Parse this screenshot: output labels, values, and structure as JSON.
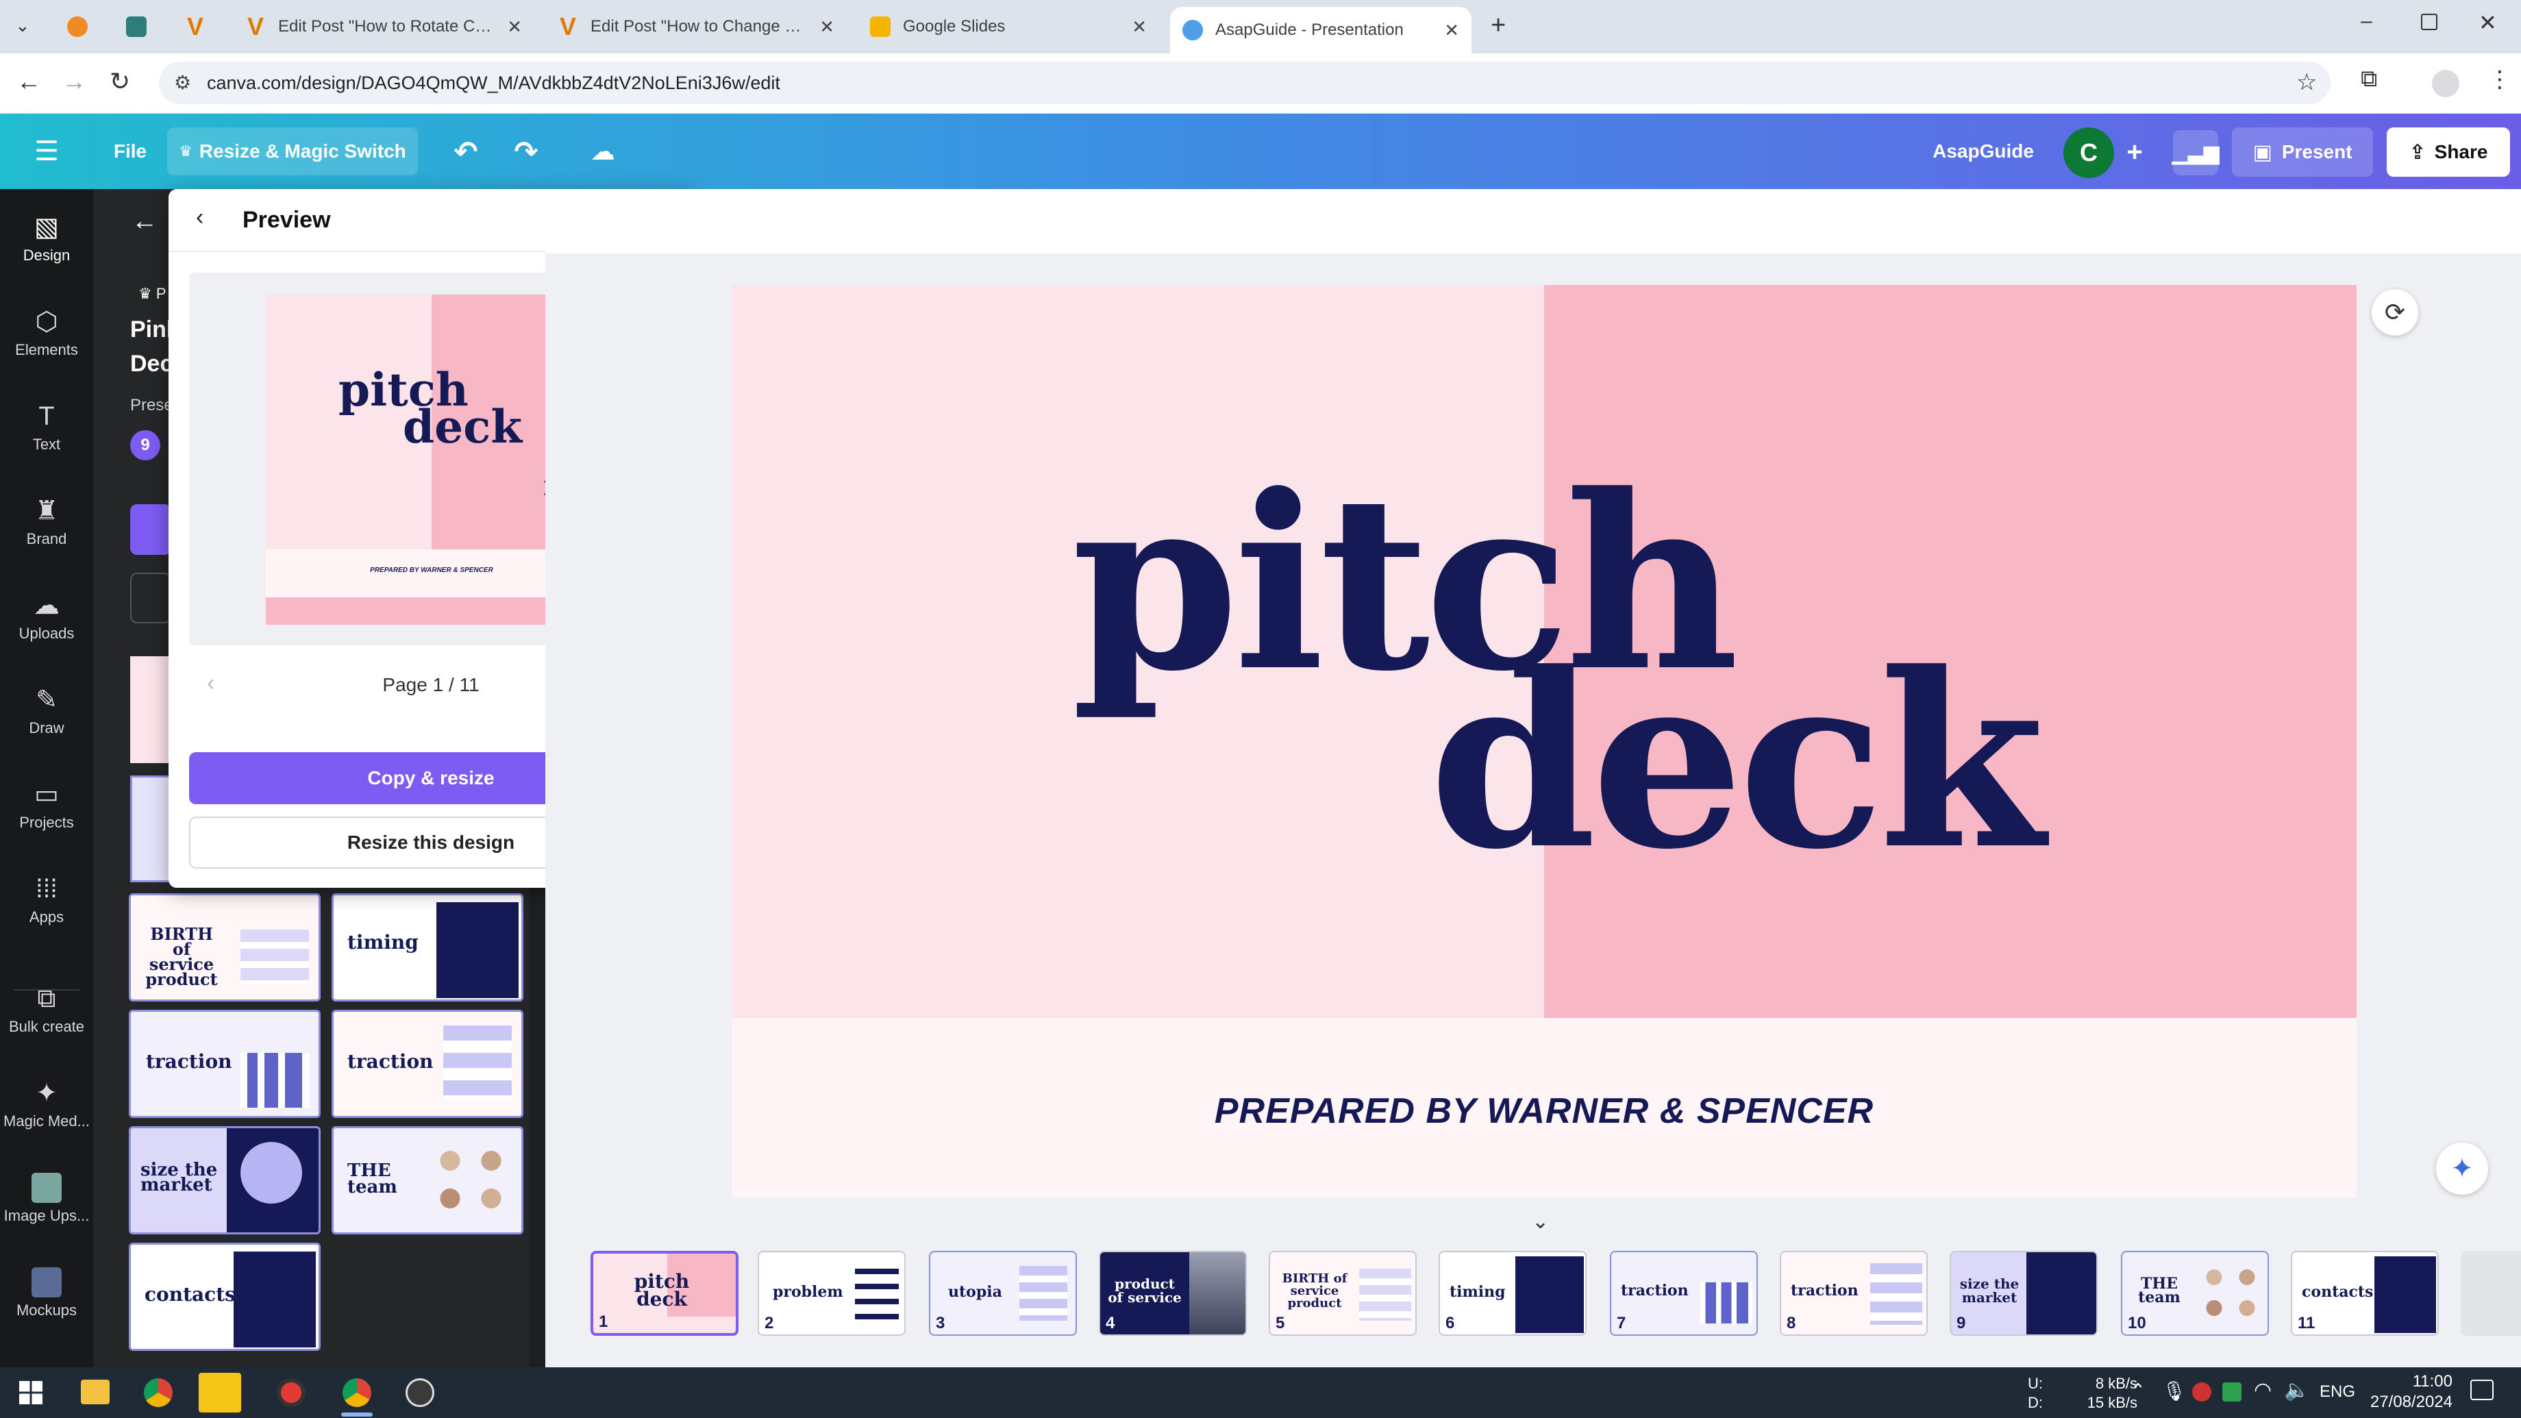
{
  "browser": {
    "tabs": [
      {
        "title": "",
        "icon": "firefox-icon"
      },
      {
        "title": "",
        "icon": "app-icon"
      },
      {
        "title": "",
        "icon": "v-icon"
      },
      {
        "title": "Edit Post \"How to Rotate Canva",
        "icon": "v-icon"
      },
      {
        "title": "Edit Post \"How to Change Canv",
        "icon": "v-icon"
      },
      {
        "title": "Google Slides",
        "icon": "slides-icon"
      },
      {
        "title": "AsapGuide - Presentation",
        "icon": "canva-icon",
        "active": true
      }
    ],
    "url": "canva.com/design/DAGO4QmQW_M/AVdkbbZ4dtV2NoLEni3J6w/edit"
  },
  "header": {
    "menu": "File",
    "resize": "Resize & Magic Switch",
    "team": "AsapGuide",
    "avatar": "C",
    "present": "Present",
    "share": "Share"
  },
  "rail": [
    {
      "label": "Design",
      "icon": "design-icon"
    },
    {
      "label": "Elements",
      "icon": "elements-icon"
    },
    {
      "label": "Text",
      "icon": "text-icon"
    },
    {
      "label": "Brand",
      "icon": "brand-icon"
    },
    {
      "label": "Uploads",
      "icon": "uploads-icon"
    },
    {
      "label": "Draw",
      "icon": "draw-icon"
    },
    {
      "label": "Projects",
      "icon": "projects-icon"
    },
    {
      "label": "Apps",
      "icon": "apps-icon"
    },
    {
      "label": "Bulk create",
      "icon": "bulk-create-icon"
    },
    {
      "label": "Magic Med...",
      "icon": "magic-media-icon"
    },
    {
      "label": "Image Ups...",
      "icon": "image-upscaler-icon"
    },
    {
      "label": "Mockups",
      "icon": "mockups-icon"
    }
  ],
  "panel": {
    "partial_title_1": "Pink",
    "partial_title_2": "Dec",
    "partial_sub": "Prese",
    "partial_badge": "P",
    "count": "9",
    "gallery": [
      {
        "text": "BIRTH of service product"
      },
      {
        "text": "timing"
      },
      {
        "text": "traction"
      },
      {
        "text": "traction"
      },
      {
        "text": "size the market"
      },
      {
        "text": "THE team"
      },
      {
        "text": "contacts"
      }
    ]
  },
  "preview": {
    "title": "Preview",
    "thumb_title_1": "pitch",
    "thumb_title_2": "deck",
    "thumb_sub": "PREPARED BY WARNER & SPENCER",
    "page": "Page 1 / 11",
    "copy_resize": "Copy & resize",
    "resize_this": "Resize this design"
  },
  "slide": {
    "line1": "pitch",
    "line2": "deck",
    "subtitle": "PREPARED BY WARNER & SPENCER"
  },
  "filmstrip": [
    {
      "n": "1",
      "text": "pitch deck"
    },
    {
      "n": "2",
      "text": "problem"
    },
    {
      "n": "3",
      "text": "utopia"
    },
    {
      "n": "4",
      "text": "product of service"
    },
    {
      "n": "5",
      "text": "BIRTH of service product"
    },
    {
      "n": "6",
      "text": "timing"
    },
    {
      "n": "7",
      "text": "traction"
    },
    {
      "n": "8",
      "text": "traction"
    },
    {
      "n": "9",
      "text": "size the market"
    },
    {
      "n": "10",
      "text": "THE team"
    },
    {
      "n": "11",
      "text": "contacts"
    }
  ],
  "taskbar": {
    "net_up_label": "U:",
    "net_down_label": "D:",
    "net_up": "8 kB/s",
    "net_down": "15 kB/s",
    "lang": "ENG",
    "time": "11:00",
    "date": "27/08/2024"
  },
  "colors": {
    "navy": "#151a56",
    "pink": "#f7b7c4",
    "light_pink": "#fbe4ea",
    "purple": "#7c5cf3",
    "header_start": "#21bccf",
    "header_end": "#6b5ee6"
  }
}
